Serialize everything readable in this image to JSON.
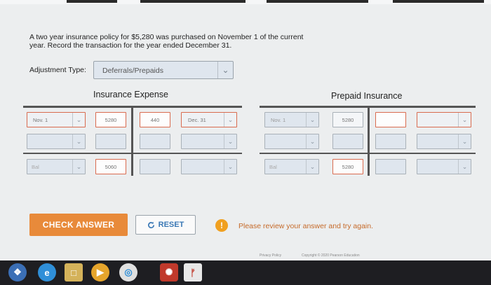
{
  "question": {
    "text": "A two year insurance policy for $5,280 was purchased on November 1 of the current year. Record the transaction for the year ended December 31."
  },
  "adjustment": {
    "label": "Adjustment Type:",
    "selected": "Deferrals/Prepaids"
  },
  "accounts": {
    "insurance_expense": {
      "title": "Insurance Expense",
      "row1": {
        "date": "Nov. 1",
        "debit": "5280",
        "credit": "440",
        "credit_date": "Dec. 31"
      },
      "balance": {
        "date": "Bal",
        "amount": "5060"
      }
    },
    "prepaid_insurance": {
      "title": "Prepaid Insurance",
      "row1": {
        "date": "Nov. 1",
        "debit": "5280"
      },
      "balance": {
        "date": "Bal",
        "amount": "5280"
      }
    }
  },
  "buttons": {
    "check_answer": "CHECK ANSWER",
    "reset": "RESET"
  },
  "feedback": {
    "icon": "!",
    "message": "Please review your answer and try again."
  },
  "footer": {
    "privacy": "Privacy Policy",
    "copyright": "Copyright © 2020 Pearson Education"
  },
  "taskbar": {
    "icons": [
      "windows-start",
      "internet-explorer",
      "file-explorer",
      "media-player",
      "chrome",
      "paint",
      "acrobat"
    ]
  },
  "colors": {
    "accent_orange": "#e88a3a",
    "error_red": "#d96b4f",
    "reset_blue": "#3a78b5",
    "warning": "#f0a020"
  }
}
